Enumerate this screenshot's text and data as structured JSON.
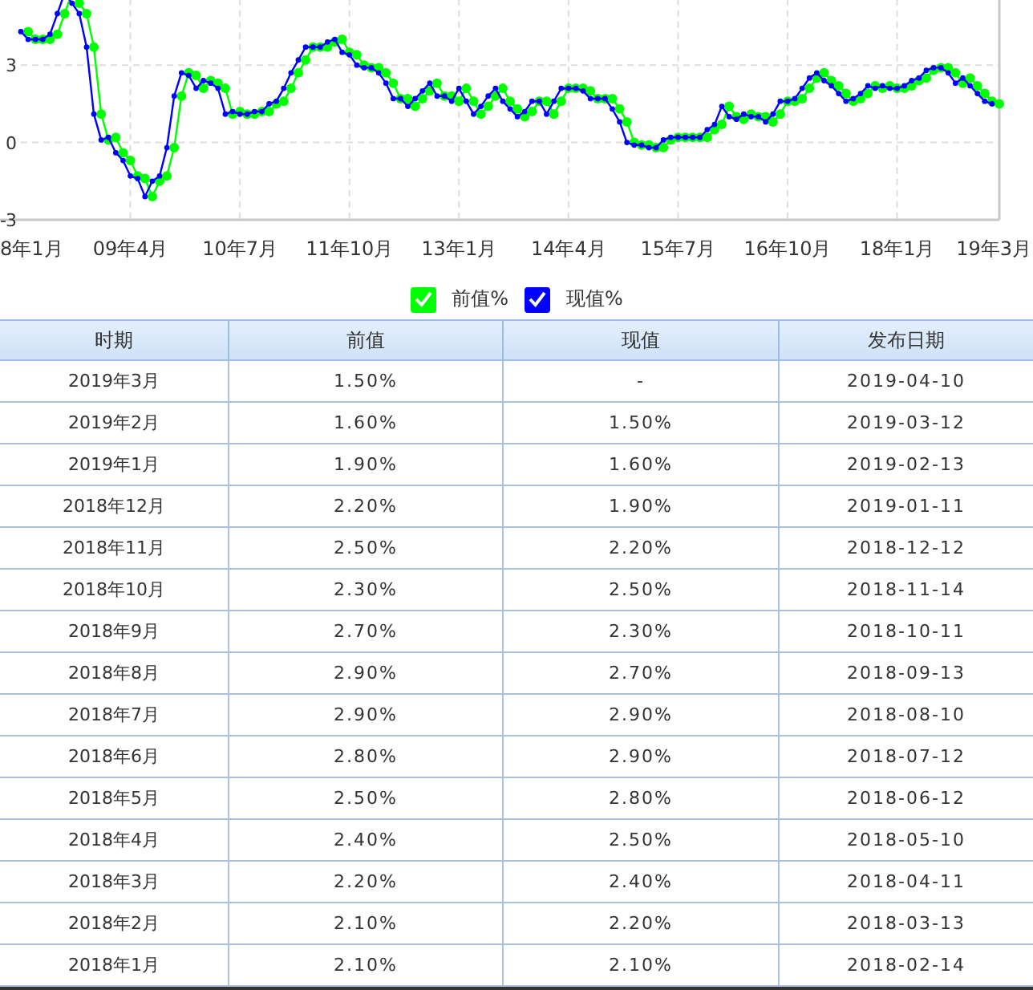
{
  "chart_data": {
    "type": "line",
    "ylim": [
      -3,
      6
    ],
    "categories": [
      "8年1月",
      null,
      null,
      null,
      null,
      null,
      null,
      null,
      null,
      null,
      null,
      null,
      null,
      null,
      null,
      "09年4月",
      null,
      null,
      null,
      null,
      null,
      null,
      null,
      null,
      null,
      null,
      null,
      null,
      null,
      null,
      "10年7月",
      null,
      null,
      null,
      null,
      null,
      null,
      null,
      null,
      null,
      null,
      null,
      null,
      null,
      null,
      "11年10月",
      null,
      null,
      null,
      null,
      null,
      null,
      null,
      null,
      null,
      null,
      null,
      null,
      null,
      null,
      "13年1月",
      null,
      null,
      null,
      null,
      null,
      null,
      null,
      null,
      null,
      null,
      null,
      null,
      null,
      null,
      "14年4月",
      null,
      null,
      null,
      null,
      null,
      null,
      null,
      null,
      null,
      null,
      null,
      null,
      null,
      null,
      "15年7月",
      null,
      null,
      null,
      null,
      null,
      null,
      null,
      null,
      null,
      null,
      null,
      null,
      null,
      null,
      "16年10月",
      null,
      null,
      null,
      null,
      null,
      null,
      null,
      null,
      null,
      null,
      null,
      null,
      null,
      null,
      "18年1月",
      null,
      null,
      null,
      null,
      null,
      null,
      null,
      null,
      null,
      null,
      null,
      null,
      null,
      "19年3月"
    ],
    "yticks": [
      {
        "value": 3,
        "label": "3"
      },
      {
        "value": 0,
        "label": "0"
      },
      {
        "value": -3,
        "label": "-3"
      }
    ],
    "series": [
      {
        "name": "前值%",
        "color": "#00ff00",
        "marker": "circle",
        "values": [
          null,
          4.3,
          4.0,
          4.0,
          4.0,
          4.2,
          5.0,
          5.8,
          5.4,
          5.0,
          3.7,
          1.1,
          0.1,
          0.2,
          -0.4,
          -0.7,
          -1.3,
          -1.4,
          -2.1,
          -1.5,
          -1.3,
          -0.2,
          1.8,
          2.7,
          2.6,
          2.1,
          2.4,
          2.3,
          2.1,
          1.1,
          1.2,
          1.1,
          1.1,
          1.2,
          1.2,
          1.5,
          1.6,
          2.1,
          2.7,
          3.2,
          3.7,
          3.7,
          3.7,
          3.9,
          4.0,
          3.5,
          3.4,
          3.0,
          2.9,
          2.9,
          2.7,
          2.3,
          1.7,
          1.7,
          1.4,
          1.7,
          2.0,
          2.3,
          1.8,
          1.8,
          1.6,
          2.1,
          1.6,
          1.1,
          1.4,
          1.8,
          2.1,
          1.6,
          1.3,
          1.0,
          1.2,
          1.6,
          1.6,
          1.1,
          1.6,
          2.1,
          2.1,
          2.1,
          2.0,
          1.7,
          1.7,
          1.7,
          1.3,
          0.8,
          0.0,
          -0.1,
          -0.1,
          -0.2,
          -0.2,
          0.1,
          0.2,
          0.2,
          0.2,
          0.2,
          0.2,
          0.5,
          0.7,
          1.4,
          1.0,
          0.9,
          1.1,
          1.0,
          1.0,
          0.8,
          1.1,
          1.6,
          1.6,
          1.7,
          2.1,
          2.5,
          2.7,
          2.4,
          2.2,
          1.9,
          1.6,
          1.7,
          1.9,
          2.2,
          2.1,
          2.2,
          2.1,
          2.1,
          2.2,
          2.4,
          2.5,
          2.8,
          2.9,
          2.9,
          2.7,
          2.3,
          2.5,
          2.2,
          1.9,
          1.6,
          1.5
        ]
      },
      {
        "name": "现值%",
        "color": "#0000ff",
        "marker": "circle",
        "values": [
          4.3,
          4.0,
          4.0,
          4.0,
          4.2,
          5.0,
          5.8,
          5.4,
          5.0,
          3.7,
          1.1,
          0.1,
          0.2,
          -0.4,
          -0.7,
          -1.3,
          -1.4,
          -2.1,
          -1.5,
          -1.3,
          -0.2,
          1.8,
          2.7,
          2.6,
          2.1,
          2.4,
          2.3,
          2.1,
          1.1,
          1.2,
          1.1,
          1.1,
          1.2,
          1.2,
          1.5,
          1.6,
          2.1,
          2.7,
          3.2,
          3.7,
          3.7,
          3.7,
          3.9,
          4.0,
          3.5,
          3.4,
          3.0,
          2.9,
          2.9,
          2.7,
          2.3,
          1.7,
          1.7,
          1.4,
          1.7,
          2.0,
          2.3,
          1.8,
          1.8,
          1.6,
          2.1,
          1.6,
          1.1,
          1.4,
          1.8,
          2.1,
          1.6,
          1.3,
          1.0,
          1.2,
          1.6,
          1.6,
          1.1,
          1.6,
          2.1,
          2.1,
          2.1,
          2.0,
          1.7,
          1.7,
          1.7,
          1.3,
          0.8,
          0.0,
          -0.1,
          -0.1,
          -0.2,
          -0.2,
          0.1,
          0.2,
          0.2,
          0.2,
          0.2,
          0.2,
          0.5,
          0.7,
          1.4,
          1.0,
          0.9,
          1.1,
          1.0,
          1.0,
          0.8,
          1.1,
          1.6,
          1.6,
          1.7,
          2.1,
          2.5,
          2.7,
          2.4,
          2.2,
          1.9,
          1.6,
          1.7,
          1.9,
          2.2,
          2.1,
          2.2,
          2.1,
          2.1,
          2.2,
          2.4,
          2.5,
          2.8,
          2.9,
          2.9,
          2.7,
          2.3,
          2.5,
          2.2,
          1.9,
          1.6,
          1.5,
          null
        ]
      }
    ]
  },
  "legend": [
    {
      "checked": true
    },
    {
      "checked": true
    }
  ],
  "table": {
    "columns": [
      "时期",
      "前值",
      "现值",
      "发布日期"
    ],
    "rows": [
      [
        "2019年3月",
        "1.50%",
        "-",
        "2019-04-10"
      ],
      [
        "2019年2月",
        "1.60%",
        "1.50%",
        "2019-03-12"
      ],
      [
        "2019年1月",
        "1.90%",
        "1.60%",
        "2019-02-13"
      ],
      [
        "2018年12月",
        "2.20%",
        "1.90%",
        "2019-01-11"
      ],
      [
        "2018年11月",
        "2.50%",
        "2.20%",
        "2018-12-12"
      ],
      [
        "2018年10月",
        "2.30%",
        "2.50%",
        "2018-11-14"
      ],
      [
        "2018年9月",
        "2.70%",
        "2.30%",
        "2018-10-11"
      ],
      [
        "2018年8月",
        "2.90%",
        "2.70%",
        "2018-09-13"
      ],
      [
        "2018年7月",
        "2.90%",
        "2.90%",
        "2018-08-10"
      ],
      [
        "2018年6月",
        "2.80%",
        "2.90%",
        "2018-07-12"
      ],
      [
        "2018年5月",
        "2.50%",
        "2.80%",
        "2018-06-12"
      ],
      [
        "2018年4月",
        "2.40%",
        "2.50%",
        "2018-05-10"
      ],
      [
        "2018年3月",
        "2.20%",
        "2.40%",
        "2018-04-11"
      ],
      [
        "2018年2月",
        "2.10%",
        "2.20%",
        "2018-03-13"
      ],
      [
        "2018年1月",
        "2.10%",
        "2.10%",
        "2018-02-14"
      ]
    ]
  }
}
